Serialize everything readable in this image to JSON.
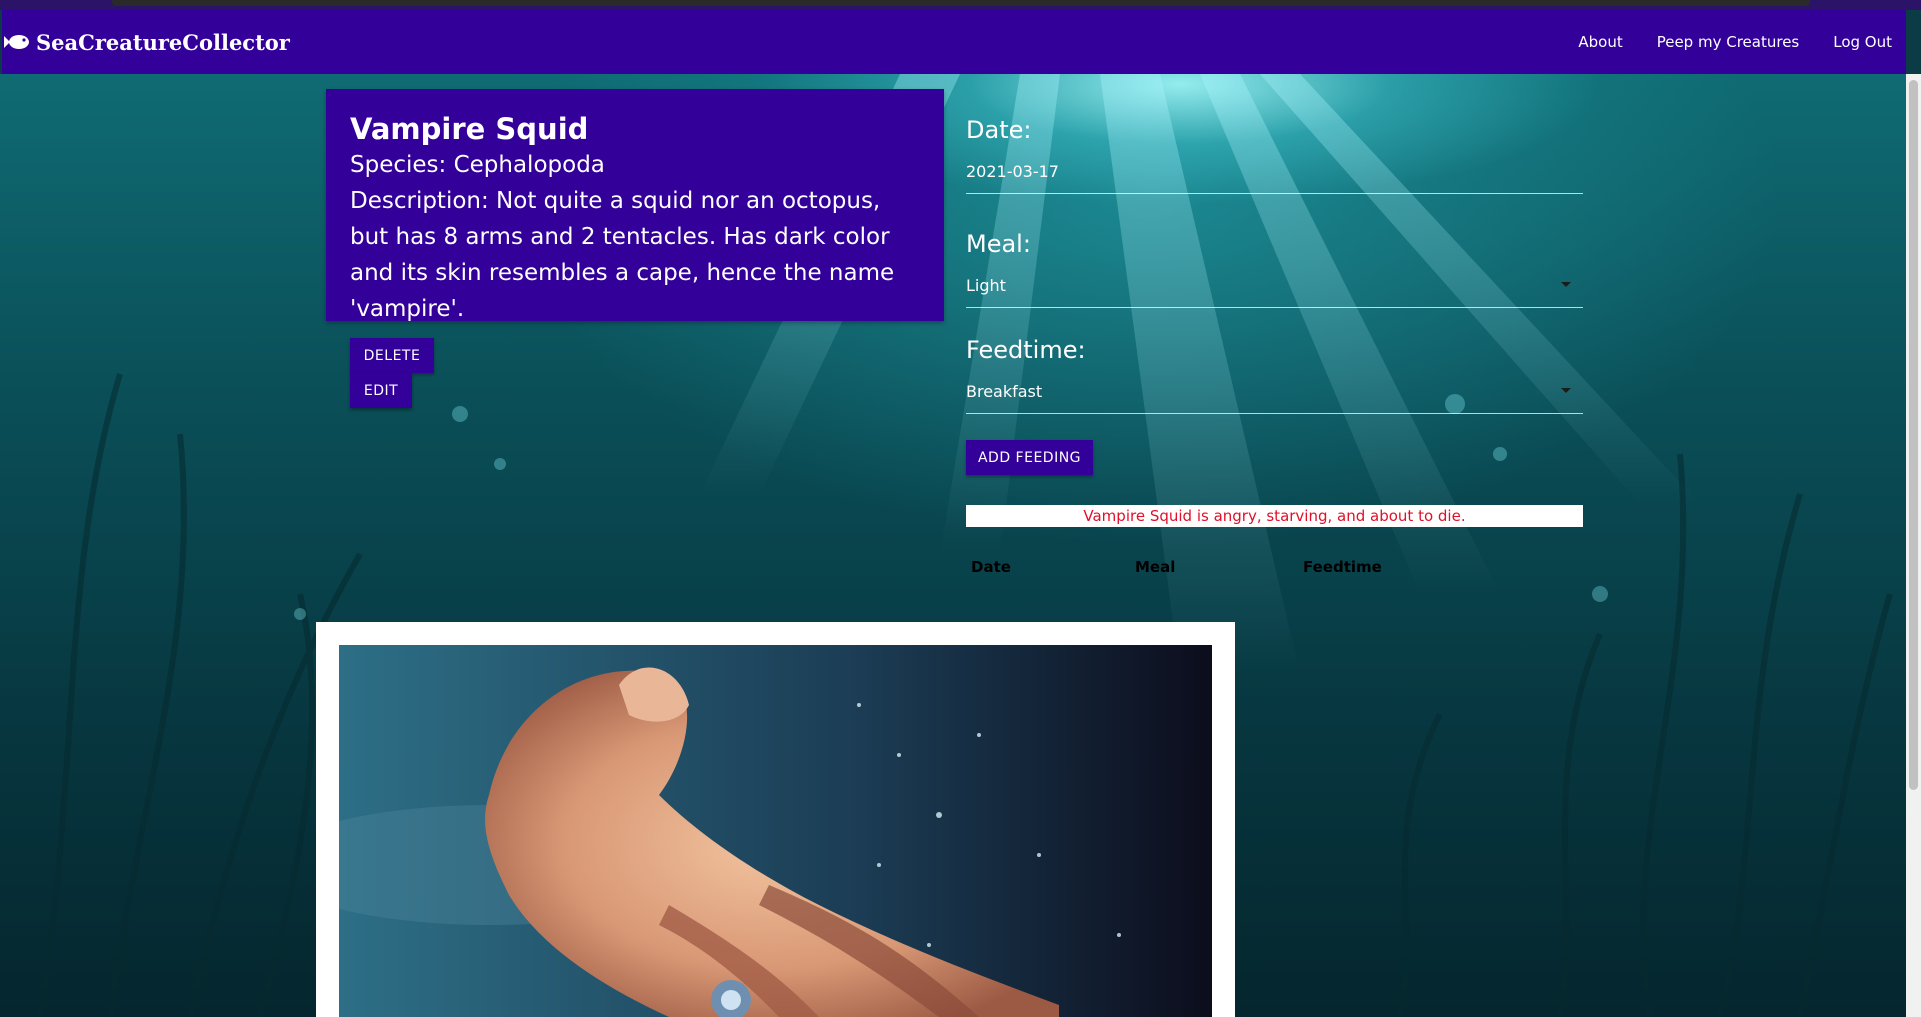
{
  "brand": {
    "name": "SeaCreatureCollector",
    "icon": "fish-icon"
  },
  "nav": {
    "links": [
      "About",
      "Peep my Creatures",
      "Log Out"
    ]
  },
  "creature": {
    "name": "Vampire Squid",
    "species": "Species: Cephalopoda",
    "description": "Description: Not quite a squid nor an octopus, but has 8 arms and 2 tentacles. Has dark color and its skin resembles a cape, hence the name 'vampire'."
  },
  "buttons": {
    "delete": "DELETE",
    "edit": "EDIT",
    "add_feeding": "ADD FEEDING"
  },
  "form": {
    "date_label": "Date:",
    "date_value": "2021-03-17",
    "meal_label": "Meal:",
    "meal_value": "Light",
    "feedtime_label": "Feedtime:",
    "feedtime_value": "Breakfast"
  },
  "status": "Vampire Squid is angry, starving, and about to die.",
  "table": {
    "headers": [
      "Date",
      "Meal",
      "Feedtime"
    ]
  },
  "colors": {
    "primary": "#330099",
    "alert_text": "#e0102a"
  }
}
